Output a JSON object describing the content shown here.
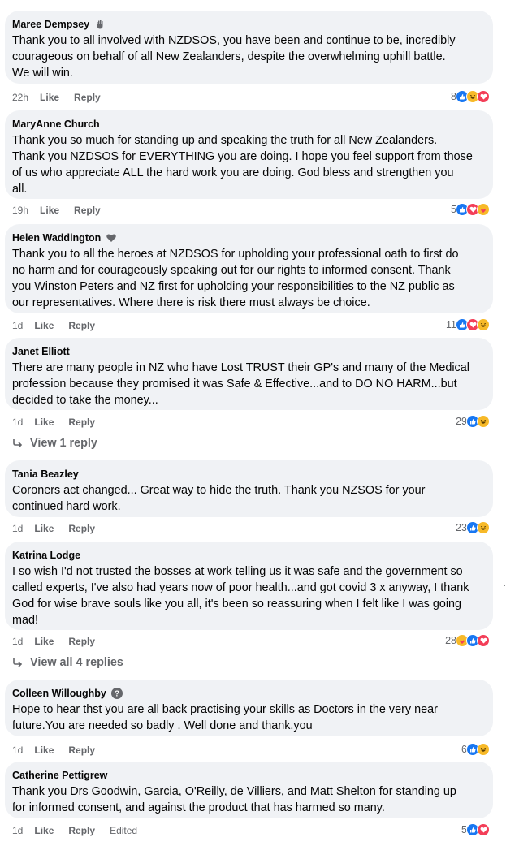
{
  "comments": [
    {
      "author": "Maree Dempsey",
      "badge": "hand-badge-icon",
      "lines": [
        "Thank you to all involved with NZDSOS, you have been and continue to be, incredibly",
        "courageous on behalf of all New Zealanders, despite the overwhelming uphill battle.",
        "We will win."
      ],
      "time": "22h",
      "like": "Like",
      "reply": "Reply",
      "reaction_count": "8",
      "reactions": [
        "like",
        "haha",
        "love"
      ]
    },
    {
      "author": "MaryAnne Church",
      "lines": [
        "Thank you so much for standing up and speaking the truth for all New Zealanders.",
        "Thank you NZDSOS for EVERYTHING you are doing. I hope you feel support from those",
        "of us who appreciate ALL the hard work you are doing. God bless and strengthen you",
        "all."
      ],
      "time": "19h",
      "like": "Like",
      "reply": "Reply",
      "reaction_count": "5",
      "reactions": [
        "like",
        "love",
        "care"
      ]
    },
    {
      "author": "Helen Waddington",
      "badge": "heart-badge-icon",
      "lines": [
        "Thank you to all the heroes at NZDSOS for upholding your professional oath to first do",
        "no harm and for courageously speaking out for our rights to informed consent. Thank",
        "you Winston Peters and NZ first for upholding your responsibilities to the NZ public as",
        "our representatives. Where there is risk there must always be choice."
      ],
      "time": "1d",
      "like": "Like",
      "reply": "Reply",
      "reaction_count": "11",
      "reactions": [
        "like",
        "love",
        "haha"
      ]
    },
    {
      "author": "Janet Elliott",
      "lines": [
        "There are many people in NZ who have Lost TRUST their GP's and many of the Medical",
        "profession because they promised it was Safe & Effective...and to DO NO HARM...but",
        "decided to take the money..."
      ],
      "time": "1d",
      "like": "Like",
      "reply": "Reply",
      "reaction_count": "29",
      "reactions": [
        "like",
        "haha"
      ],
      "view_replies": "View 1 reply"
    },
    {
      "author": "Tania Beazley",
      "lines": [
        "Coroners act changed... Great way to hide the truth. Thank you NZSOS for your",
        "continued hard work."
      ],
      "time": "1d",
      "like": "Like",
      "reply": "Reply",
      "reaction_count": "23",
      "reactions": [
        "like",
        "haha"
      ]
    },
    {
      "author": "Katrina Lodge",
      "lines": [
        "I so wish I'd not trusted the bosses at work telling us it was safe and the government so",
        "called experts, I've also had years now of poor health...and got covid 3 x anyway, I thank",
        "God for wise brave souls like you all, it's been so reassuring when I felt like I was going",
        "mad!"
      ],
      "time": "1d",
      "like": "Like",
      "reply": "Reply",
      "reaction_count": "28",
      "reactions": [
        "care",
        "like",
        "love"
      ],
      "view_replies": "View all 4 replies"
    },
    {
      "author": "Colleen Willoughby",
      "badge": "question-badge-icon",
      "lines": [
        "Hope to hear thst you are all back practising your skills as Doctors in the very near",
        "future.You are needed so badly . Well done and thank.you"
      ],
      "time": "1d",
      "like": "Like",
      "reply": "Reply",
      "reaction_count": "6",
      "reactions": [
        "like",
        "haha"
      ]
    },
    {
      "author": "Catherine Pettigrew",
      "lines": [
        "Thank you Drs Goodwin, Garcia, O'Reilly, de Villiers, and Matt Shelton for standing up",
        "for informed consent, and against the product that has harmed so many."
      ],
      "time": "1d",
      "like": "Like",
      "reply": "Reply",
      "edited": "Edited",
      "reaction_count": "5",
      "reactions": [
        "like",
        "love"
      ]
    }
  ]
}
